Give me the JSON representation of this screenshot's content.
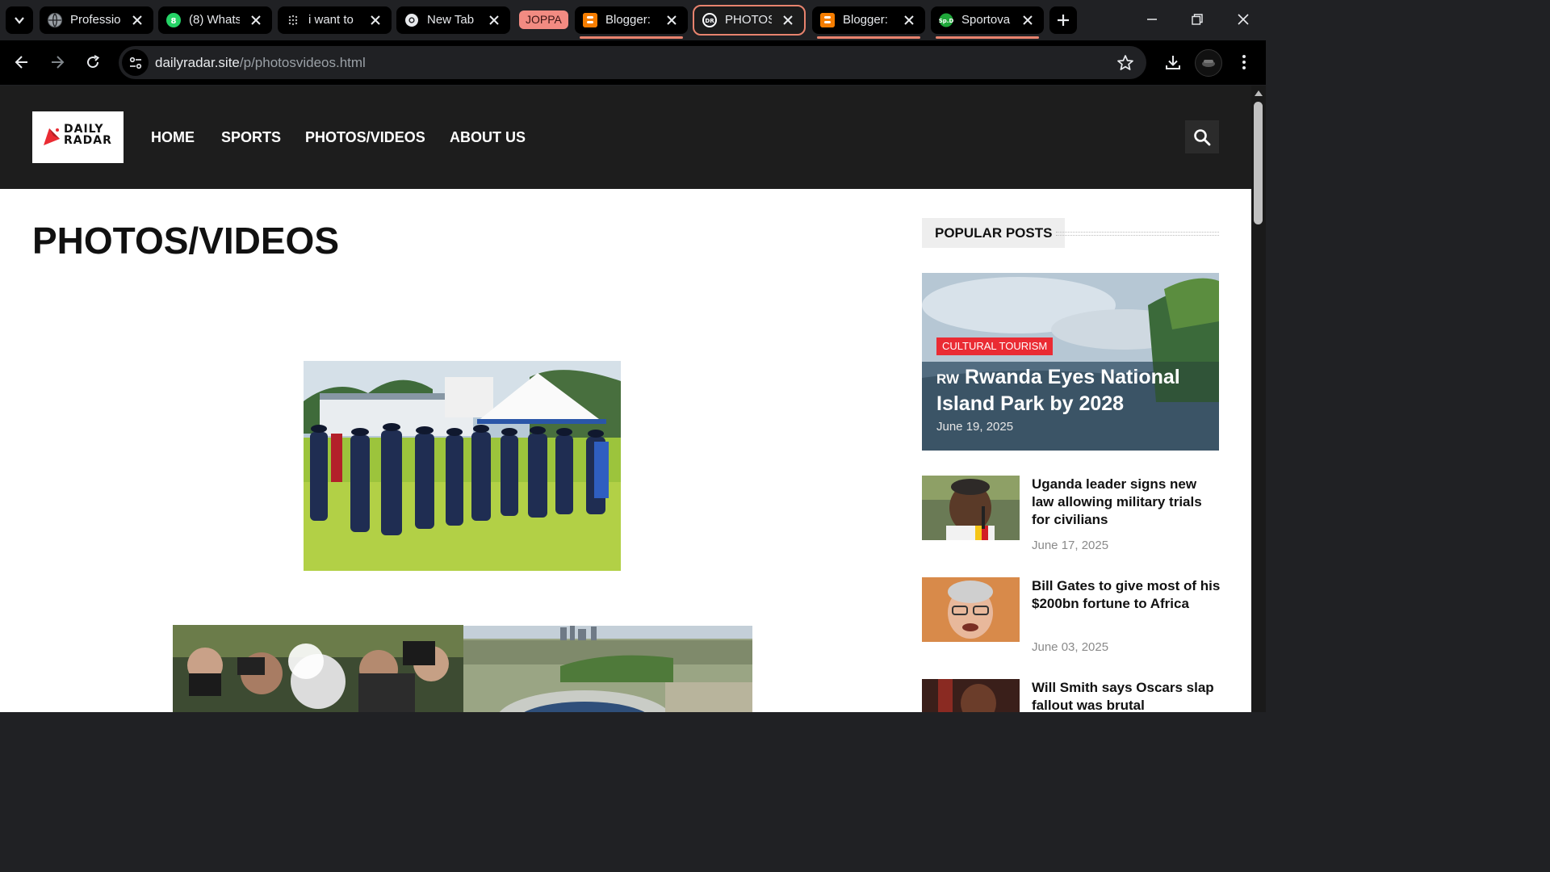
{
  "browser": {
    "tabs": [
      {
        "label": "Professio",
        "favicon": "globe-icon"
      },
      {
        "label": "(8) Whats",
        "favicon": "whatsapp-icon"
      },
      {
        "label": "i want to",
        "favicon": "sparkle-icon"
      },
      {
        "label": "New Tab",
        "favicon": "chrome-icon"
      },
      {
        "label": "Blogger:",
        "favicon": "blogger-icon"
      },
      {
        "label": "PHOTOS/",
        "favicon": "dr-icon",
        "favicon_text": "DR"
      },
      {
        "label": "Blogger:",
        "favicon": "blogger-icon"
      },
      {
        "label": "Sportova",
        "favicon": "sportova-icon",
        "favicon_text": "Sp.D"
      }
    ],
    "tab_group_label": "JOPPA",
    "url_host": "dailyradar.site",
    "url_path": "/p/photosvideos.html",
    "colors": {
      "tab_group": "#f28b82",
      "active_outline": "#e8836e"
    }
  },
  "site": {
    "logo_line1": "DAILY",
    "logo_line2": "RADAR",
    "nav": [
      "HOME",
      "SPORTS",
      "PHOTOS/VIDEOS",
      "ABOUT US"
    ],
    "accent": "#ea2b33"
  },
  "page": {
    "title": "PHOTOS/VIDEOS"
  },
  "sidebar": {
    "heading": "POPULAR POSTS",
    "featured": {
      "category": "CULTURAL TOURISM",
      "flag": "RW",
      "title": "Rwanda Eyes National Island Park by 2028",
      "date": "June 19, 2025"
    },
    "posts": [
      {
        "title": "Uganda leader signs new law allowing military trials for civilians",
        "date": "June 17, 2025"
      },
      {
        "title": "Bill Gates to give most of his $200bn fortune to Africa",
        "date": "June 03, 2025"
      },
      {
        "title": "Will Smith says Oscars slap fallout was brutal",
        "date": ""
      }
    ]
  }
}
